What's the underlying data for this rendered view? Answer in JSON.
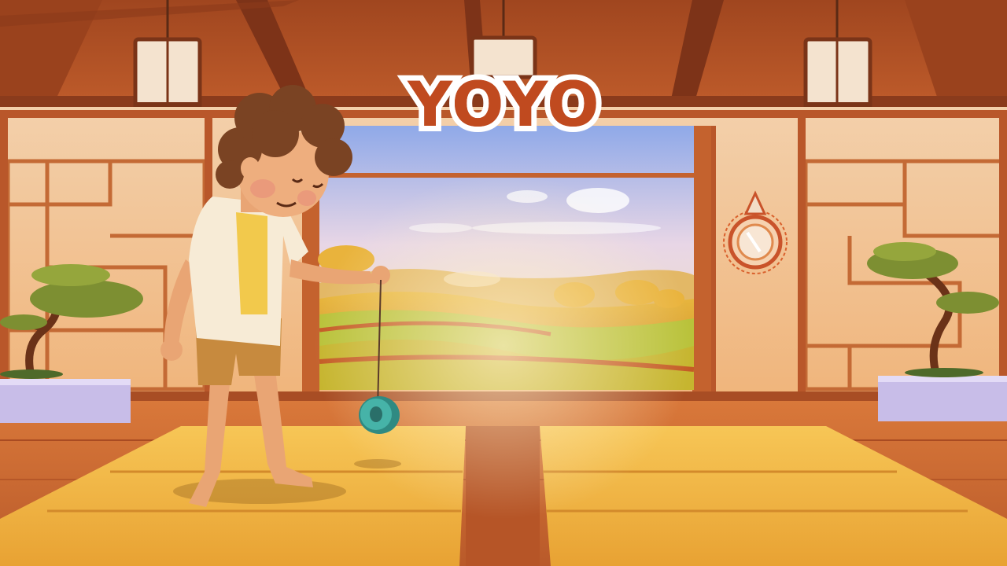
{
  "game": {
    "title": "YOYO"
  },
  "palette": {
    "title_fill": "#c04a1f",
    "title_outline": "#ffffff",
    "wall": "#f0c9a0",
    "wood_dark": "#8a3b1c",
    "floor_mat": "#f2b33d",
    "yoyo": "#3fa39a",
    "sky_top": "#8fa9e8",
    "sky_bottom": "#f6e3b8"
  },
  "scene": {
    "character": "boy-playing-yoyo",
    "props": [
      "lantern-icon",
      "bonsai-icon",
      "sun-mirror-icon",
      "yoyo-icon"
    ]
  }
}
